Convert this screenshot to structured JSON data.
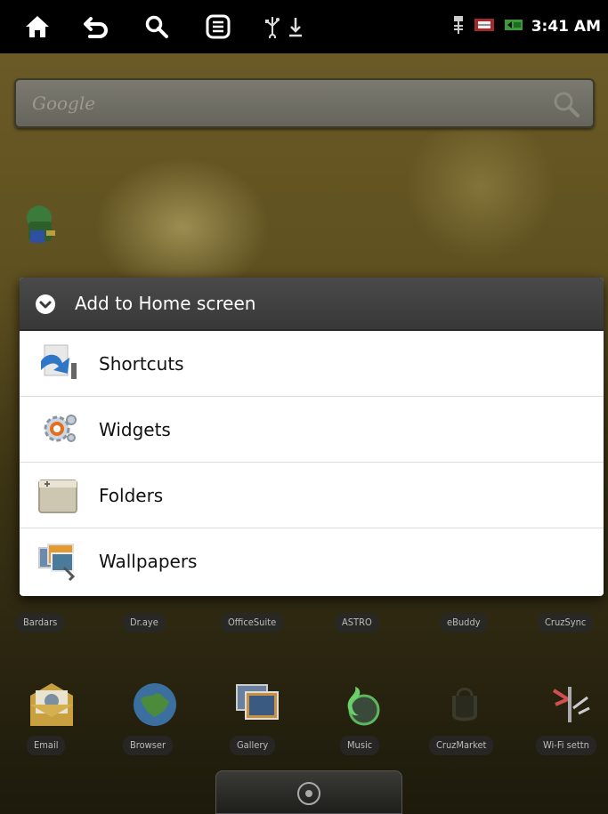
{
  "status_bar": {
    "icons": [
      "home-icon",
      "back-icon",
      "search-icon",
      "menu-icon",
      "usb-icon",
      "download-icon"
    ],
    "clock": "3:41 AM"
  },
  "home": {
    "search_label": "Google",
    "row1_labels": [
      "Bardars",
      "Dr.aye",
      "OfficeSuite",
      "ASTRO",
      "eBuddy",
      "CruzSync"
    ],
    "row2_labels": [
      "Email",
      "Browser",
      "Gallery",
      "Music",
      "CruzMarket",
      "Wi-Fi settn"
    ]
  },
  "dialog": {
    "title": "Add to Home screen",
    "items": [
      {
        "label": "Shortcuts",
        "icon": "shortcuts-icon"
      },
      {
        "label": "Widgets",
        "icon": "widgets-icon"
      },
      {
        "label": "Folders",
        "icon": "folder-icon"
      },
      {
        "label": "Wallpapers",
        "icon": "wallpapers-icon"
      }
    ]
  }
}
